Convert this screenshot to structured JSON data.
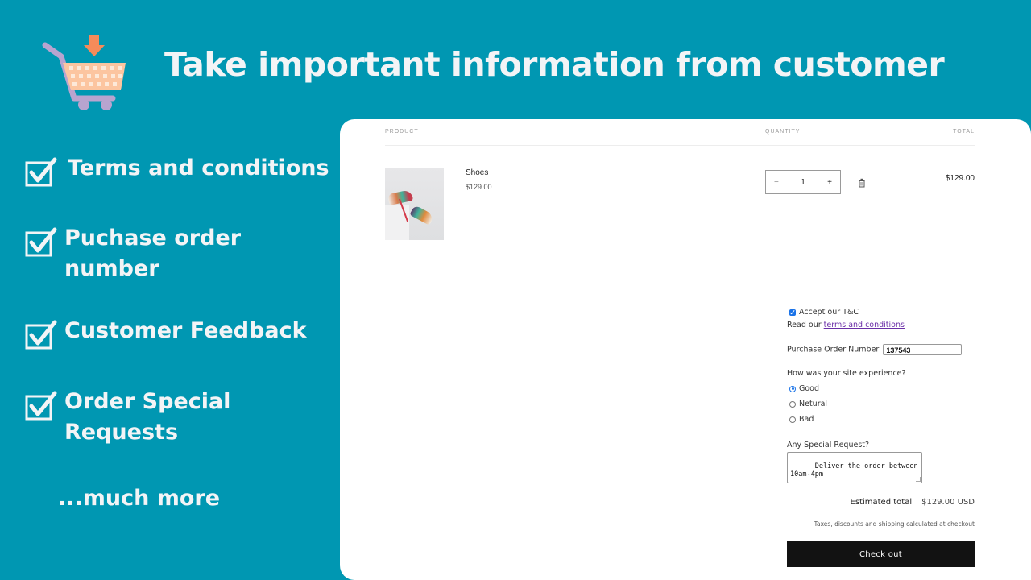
{
  "banner": {
    "headline": "Take important information from customer",
    "features": [
      {
        "label_line1": "Terms and conditions",
        "label_line2": ""
      },
      {
        "label_line1": "Puchase order",
        "label_line2": "number"
      },
      {
        "label_line1": "Customer Feedback",
        "label_line2": ""
      },
      {
        "label_line1": "Order Special",
        "label_line2": "Requests"
      }
    ],
    "more": "...much more",
    "colors": {
      "background": "#0097b2",
      "text": "#f3f4f6",
      "cart_basket": "#fcc5a0",
      "cart_arrow": "#f58b5a",
      "cart_frame": "#b8a4cf"
    }
  },
  "cart": {
    "columns": {
      "product": "PRODUCT",
      "quantity": "QUANTITY",
      "total": "TOTAL"
    },
    "items": [
      {
        "name": "Shoes",
        "price": "$129.00",
        "quantity": "1",
        "line_total": "$129.00",
        "image": "sneakers-photo"
      }
    ],
    "qty_minus": "−",
    "qty_plus": "+",
    "form": {
      "accept_tc_label": "Accept our T&C",
      "accept_tc_checked": true,
      "read_prefix": "Read our ",
      "tc_link": "terms and conditions",
      "po_label": "Purchase Order Number",
      "po_value": "137543",
      "experience_question": "How was your site experience?",
      "experience_options": [
        "Good",
        "Netural",
        "Bad"
      ],
      "experience_selected": "Good",
      "special_request_label": "Any Special Request?",
      "special_request_value": "Deliver the order between\n10am-4pm"
    },
    "estimated_total_label": "Estimated total",
    "estimated_total_value": "$129.00 USD",
    "taxes_note": "Taxes, discounts and shipping calculated at checkout",
    "checkout_label": "Check out"
  }
}
